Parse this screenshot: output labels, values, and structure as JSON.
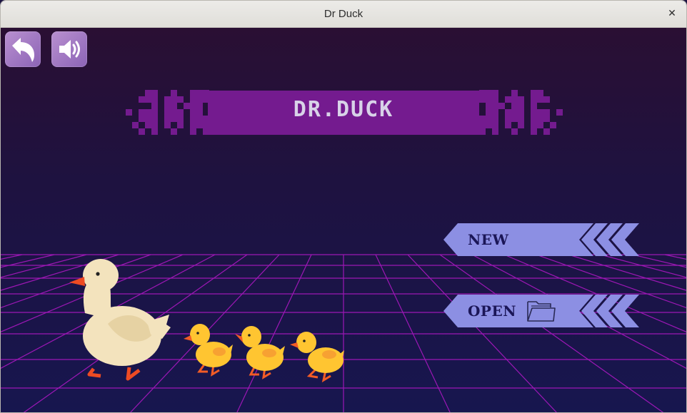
{
  "window": {
    "title": "Dr Duck",
    "close_glyph": "✕"
  },
  "toolbar": {
    "back_icon": "back-arrow-icon",
    "sound_icon": "speaker-icon"
  },
  "logo": {
    "text": "DR.DUCK"
  },
  "menu": {
    "new_label": "NEW",
    "open_label": "OPEN",
    "open_icon": "folder-icon",
    "button_color": "#8c8fe3",
    "label_color": "#1b1657"
  },
  "colors": {
    "banner": "#741b8f",
    "grid_line": "#b318c8",
    "background_top": "#2a0f33",
    "background_bottom": "#17164f"
  }
}
